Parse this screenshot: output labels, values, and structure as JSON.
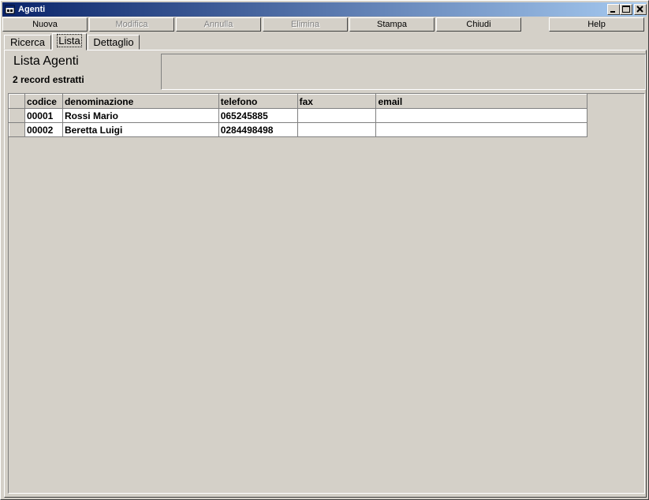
{
  "window": {
    "title": "Agenti"
  },
  "toolbar": [
    {
      "label": "Nuova",
      "enabled": true
    },
    {
      "label": "Modifica",
      "enabled": false
    },
    {
      "label": "Annulla",
      "enabled": false
    },
    {
      "label": "Elimina",
      "enabled": false
    },
    {
      "label": "Stampa",
      "enabled": true
    },
    {
      "label": "Chiudi",
      "enabled": true
    },
    {
      "label": "Help",
      "enabled": true
    }
  ],
  "tabs": [
    {
      "label": "Ricerca",
      "active": false
    },
    {
      "label": "Lista",
      "active": true
    },
    {
      "label": "Dettaglio",
      "active": false
    }
  ],
  "list": {
    "title": "Lista Agenti",
    "count": "2 record estratti",
    "columns": [
      "codice",
      "denominazione",
      "telefono",
      "fax",
      "email"
    ],
    "rows": [
      [
        "00001",
        "Rossi Mario",
        "065245885",
        "",
        ""
      ],
      [
        "00002",
        "Beretta Luigi",
        "0284498498",
        "",
        ""
      ]
    ]
  }
}
